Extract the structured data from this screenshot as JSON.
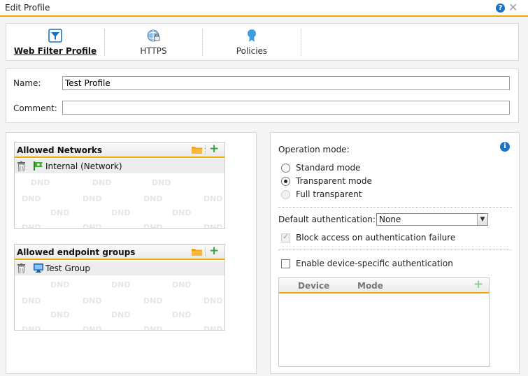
{
  "window": {
    "title": "Edit Profile",
    "help_icon": "question-icon",
    "close_icon": "close-icon"
  },
  "tabs": [
    {
      "label": "Web Filter Profile",
      "icon": "filter-icon",
      "active": true
    },
    {
      "label": "HTTPS",
      "icon": "https-lock-icon",
      "active": false
    },
    {
      "label": "Policies",
      "icon": "policy-ribbon-icon",
      "active": false
    }
  ],
  "form": {
    "name_label": "Name:",
    "name_value": "Test Profile",
    "comment_label": "Comment:",
    "comment_value": ""
  },
  "allowed_networks": {
    "title": "Allowed Networks",
    "items": [
      {
        "label": "Internal (Network)",
        "icon": "network-flag-icon"
      }
    ],
    "placeholder": "DND"
  },
  "allowed_endpoint_groups": {
    "title": "Allowed endpoint groups",
    "items": [
      {
        "label": "Test Group",
        "icon": "monitor-icon"
      }
    ],
    "placeholder": "DND"
  },
  "operation": {
    "label": "Operation mode:",
    "options": [
      {
        "label": "Standard mode",
        "selected": false,
        "disabled": false
      },
      {
        "label": "Transparent mode",
        "selected": true,
        "disabled": false
      },
      {
        "label": "Full transparent",
        "selected": false,
        "disabled": true
      }
    ]
  },
  "auth": {
    "default_label": "Default authentication:",
    "default_value": "None",
    "block_label": "Block access on authentication failure",
    "block_checked": true,
    "device_label": "Enable device-specific authentication",
    "device_checked": false
  },
  "device_table": {
    "columns": [
      "Device",
      "Mode"
    ]
  },
  "colors": {
    "accent": "#f0a800",
    "add_green": "#3aa63a",
    "info_blue": "#1a73c7"
  }
}
